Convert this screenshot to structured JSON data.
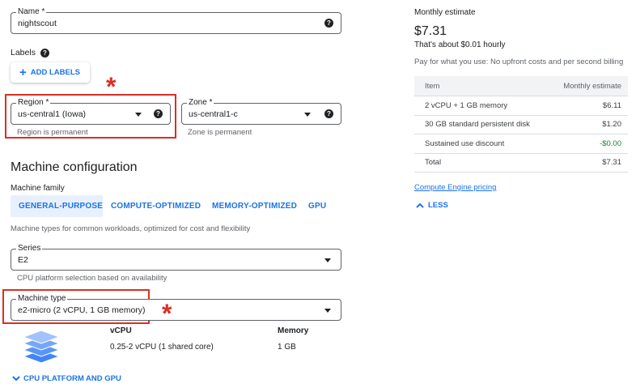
{
  "name_field": {
    "label": "Name *",
    "value": "nightscout"
  },
  "labels": {
    "title": "Labels",
    "add_button": "ADD LABELS"
  },
  "region": {
    "label": "Region *",
    "value": "us-central1 (Iowa)",
    "hint": "Region is permanent"
  },
  "zone": {
    "label": "Zone *",
    "value": "us-central1-c",
    "hint": "Zone is permanent"
  },
  "machine_config": {
    "title": "Machine configuration",
    "family_label": "Machine family",
    "tabs": [
      "GENERAL-PURPOSE",
      "COMPUTE-OPTIMIZED",
      "MEMORY-OPTIMIZED",
      "GPU"
    ],
    "family_description": "Machine types for common workloads, optimized for cost and flexibility"
  },
  "series": {
    "label": "Series",
    "value": "E2",
    "hint": "CPU platform selection based on availability"
  },
  "machine_type": {
    "label": "Machine type",
    "value": "e2-micro (2 vCPU, 1 GB memory)"
  },
  "specs": {
    "vcpu_header": "vCPU",
    "vcpu_value": "0.25-2 vCPU (1 shared core)",
    "memory_header": "Memory",
    "memory_value": "1 GB"
  },
  "cpu_platform_toggle": "CPU PLATFORM AND GPU",
  "estimate": {
    "title": "Monthly estimate",
    "price": "$7.31",
    "hourly": "That's about $0.01 hourly",
    "note": "Pay for what you use: No upfront costs and per second billing",
    "table_headers": [
      "Item",
      "Monthly estimate"
    ],
    "rows": [
      {
        "item": "2 vCPU + 1 GB memory",
        "cost": "$6.11"
      },
      {
        "item": "30 GB standard persistent disk",
        "cost": "$1.20"
      },
      {
        "item": "Sustained use discount",
        "cost": "-$0.00"
      },
      {
        "item": "Total",
        "cost": "$7.31"
      }
    ],
    "pricing_link": "Compute Engine pricing",
    "less_toggle": "LESS"
  },
  "annotation_mark": "*",
  "colors": {
    "accent": "#1a73e8",
    "annotation": "#d93025",
    "discount": "#188038"
  }
}
